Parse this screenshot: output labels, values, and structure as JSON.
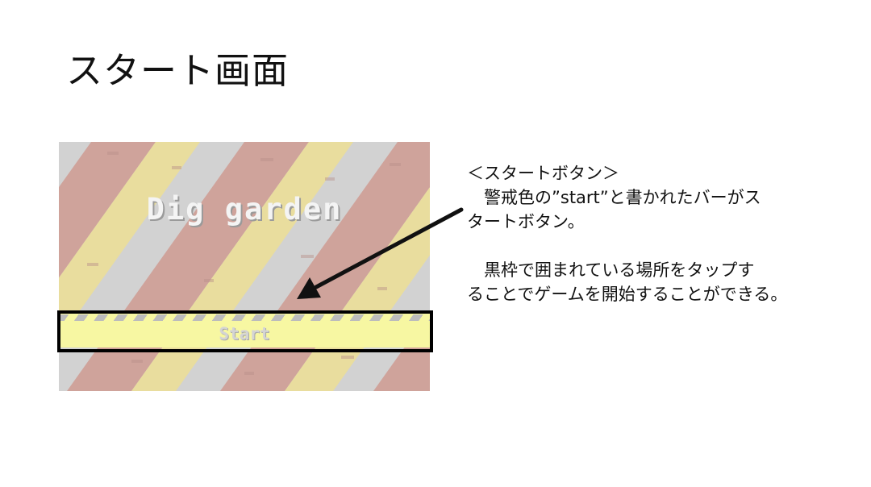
{
  "slide": {
    "title": "スタート画面"
  },
  "game_screenshot": {
    "game_title": "Dig garden",
    "start_button_label": "Start",
    "colors": {
      "background": "#d2d2d2",
      "stripe_red": "#cfa39b",
      "stripe_yellow": "#e9dd9e",
      "start_bar": "#f7f7a2",
      "highlight_frame": "#000000"
    }
  },
  "annotation": {
    "heading": "＜スタートボタン＞",
    "paragraph1_line1": "　警戒色の”start”と書かれたバーがス",
    "paragraph1_line2": "タートボタン。",
    "paragraph2_line1": "　黒枠で囲まれている場所をタップす",
    "paragraph2_line2": "ることでゲームを開始することができる。"
  }
}
